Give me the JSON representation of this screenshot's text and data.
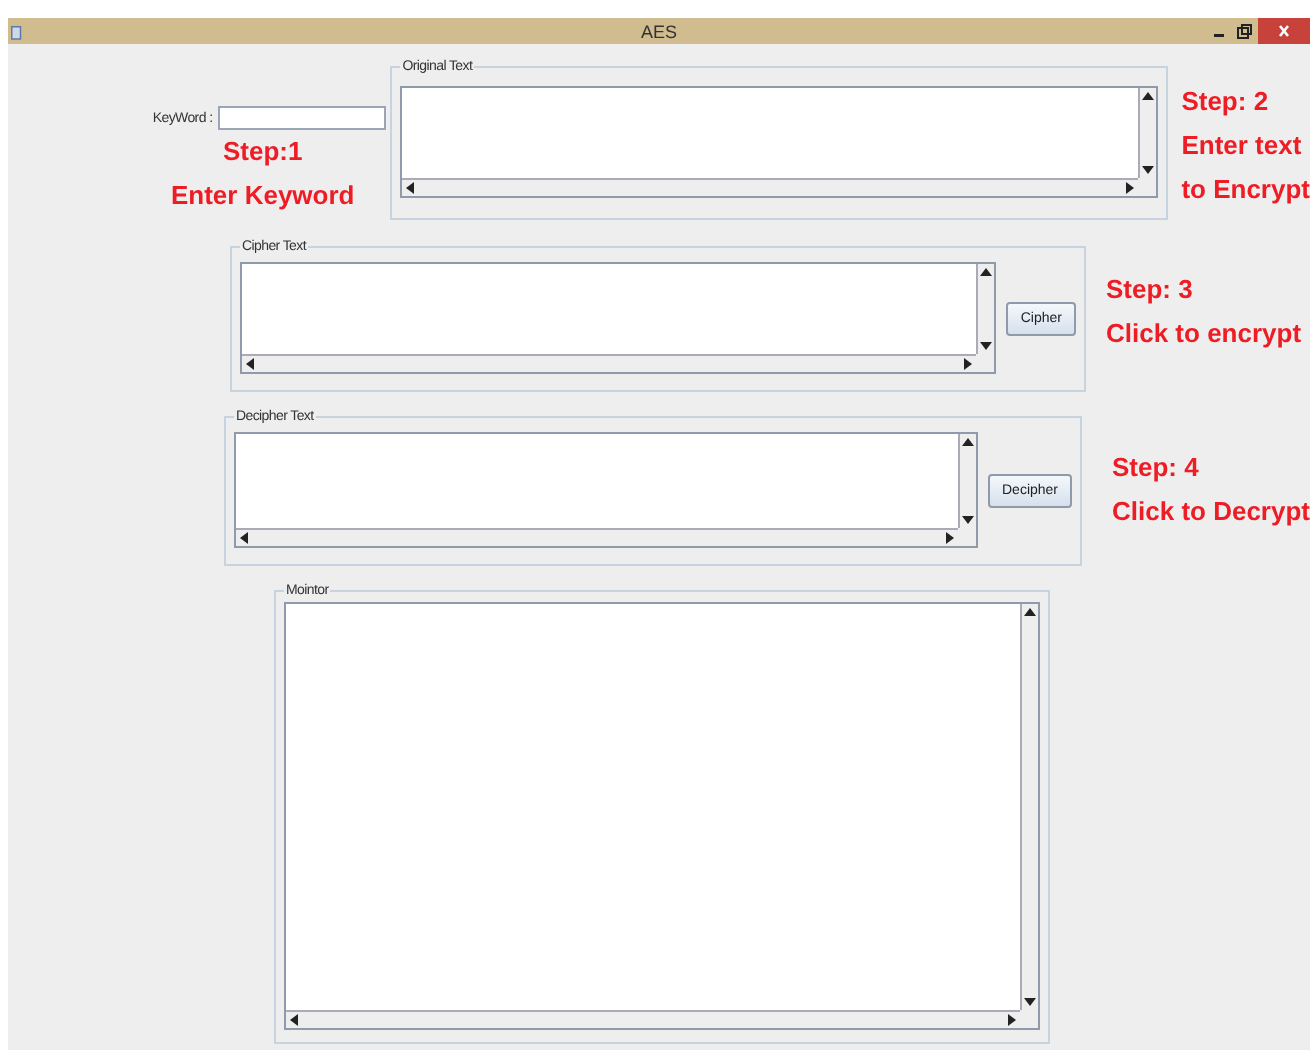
{
  "window": {
    "title": "AES"
  },
  "keyword": {
    "label": "KeyWord :"
  },
  "steps": [
    {
      "lines": [
        "Step:1",
        "Enter Keyword"
      ]
    },
    {
      "lines": [
        "Step: 2",
        "Enter text",
        "to Encrypt"
      ]
    },
    {
      "lines": [
        "Step: 3",
        "Click to encrypt"
      ]
    },
    {
      "lines": [
        "Step: 4",
        "Click to Decrypt"
      ]
    }
  ],
  "panels": [
    {
      "title": "Original Text"
    },
    {
      "title": "Cipher Text",
      "button": "Cipher"
    },
    {
      "title": "Decipher Text",
      "button": "Decipher"
    },
    {
      "title": "Mointor"
    }
  ]
}
